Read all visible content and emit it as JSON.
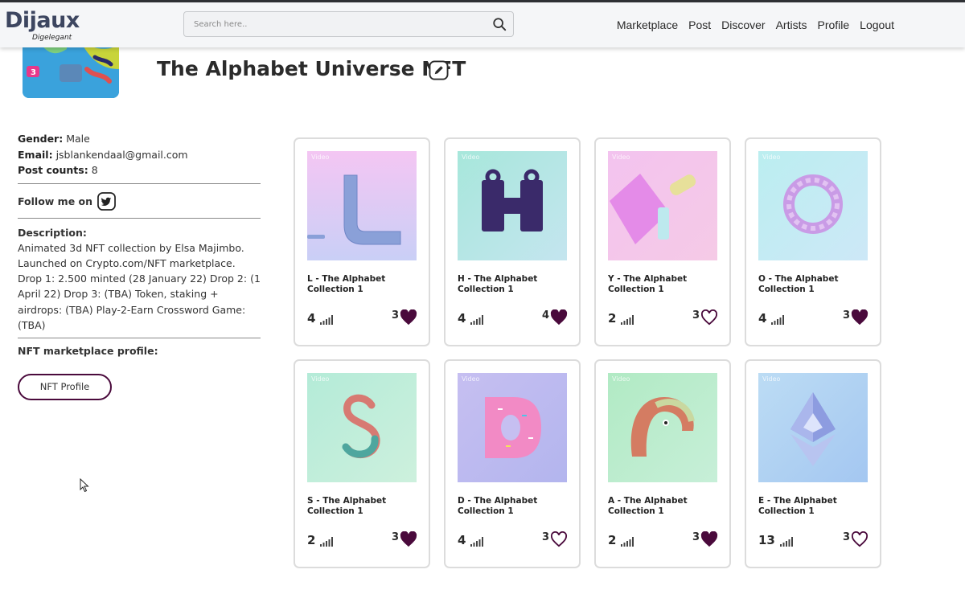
{
  "brand": {
    "name": "Dijaux",
    "tagline": "Digelegant"
  },
  "search": {
    "placeholder": "Search here..",
    "icon": "search-icon"
  },
  "nav": {
    "items": [
      "Marketplace",
      "Post",
      "Discover",
      "Artists",
      "Profile",
      "Logout"
    ]
  },
  "profile": {
    "title": "The Alphabet Universe NFT",
    "gender_label": "Gender:",
    "gender": "Male",
    "email_label": "Email:",
    "email": "jsblankendaal@gmail.com",
    "posts_label": "Post counts:",
    "posts": "8",
    "follow_label": "Follow me on",
    "description_label": "Description:",
    "description": "Animated 3d NFT collection by Elsa Majimbo. Launched on Crypto.com/NFT marketplace. Drop 1: 2.500 minted (28 January 22) Drop 2: (1 April 22) Drop 3: (TBA) Token, staking + airdrops: (TBA) Play-2-Earn Crossword Game: (TBA)",
    "marketplace_label": "NFT marketplace profile:",
    "nft_button": "NFT Profile"
  },
  "colors": {
    "accent": "#4a0a3c",
    "heart": "#4a0a3c",
    "navbg": "#f5f6f8"
  },
  "cards": [
    {
      "title": "L - The Alphabet Collection 1",
      "views": "4",
      "likes": "3",
      "liked": true,
      "video": "Video",
      "bg": [
        "#f3c8f2",
        "#c9d0f6"
      ]
    },
    {
      "title": "H - The Alphabet Collection 1",
      "views": "4",
      "likes": "4",
      "liked": true,
      "video": "Video",
      "bg": [
        "#a9e8dc",
        "#c2e6ee"
      ]
    },
    {
      "title": "Y - The Alphabet Collection 1",
      "views": "2",
      "likes": "3",
      "liked": false,
      "video": "Video",
      "bg": [
        "#f2c2ee",
        "#f6c9e6"
      ]
    },
    {
      "title": "O - The Alphabet Collection 1",
      "views": "4",
      "likes": "3",
      "liked": true,
      "video": "Video",
      "bg": [
        "#bdeef0",
        "#cbe9f6"
      ]
    },
    {
      "title": "S - The Alphabet Collection 1",
      "views": "2",
      "likes": "3",
      "liked": true,
      "video": "Video",
      "bg": [
        "#b6ecd9",
        "#cbefdc"
      ]
    },
    {
      "title": "D - The Alphabet Collection 1",
      "views": "4",
      "likes": "3",
      "liked": false,
      "video": "Video",
      "bg": [
        "#c6bef1",
        "#b5b6ee"
      ]
    },
    {
      "title": "A - The Alphabet Collection 1",
      "views": "2",
      "likes": "3",
      "liked": true,
      "video": "Video",
      "bg": [
        "#b3ebc6",
        "#c6eed8"
      ]
    },
    {
      "title": "E - The Alphabet Collection 1",
      "views": "13",
      "likes": "3",
      "liked": false,
      "video": "Video",
      "bg": [
        "#b9dcf4",
        "#a7caf2"
      ]
    }
  ]
}
